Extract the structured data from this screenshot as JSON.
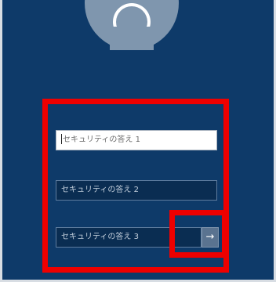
{
  "security_form": {
    "answer1_placeholder": "セキュリティの答え 1",
    "answer2_placeholder": "セキュリティの答え 2",
    "answer3_placeholder": "セキュリティの答え 3",
    "submit_icon": "arrow-right-icon",
    "submit_glyph": "→"
  },
  "colors": {
    "background": "#0e3a69",
    "highlight": "#ee0000",
    "avatar": "#7f96ae"
  },
  "icons": {
    "avatar": "user-avatar-icon"
  }
}
